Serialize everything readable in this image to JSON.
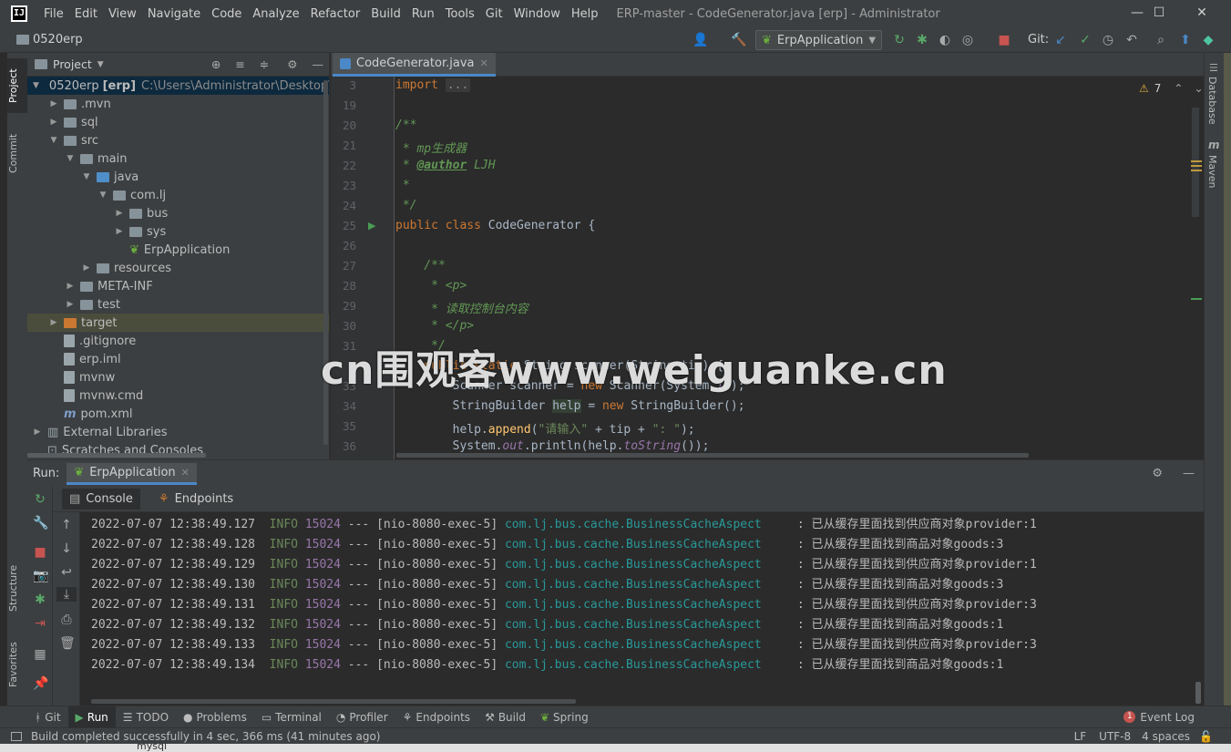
{
  "window": {
    "logo": "IJ",
    "menu": [
      "File",
      "Edit",
      "View",
      "Navigate",
      "Code",
      "Analyze",
      "Refactor",
      "Build",
      "Run",
      "Tools",
      "Git",
      "Window",
      "Help"
    ],
    "title": "ERP-master - CodeGenerator.java [erp] - Administrator",
    "minimize": "—",
    "maximize": "☐",
    "close": "✕"
  },
  "navbar": {
    "project": "0520erp",
    "run_config": "ErpApplication",
    "git_label": "Git:"
  },
  "left_strip": {
    "tabs": [
      "Project",
      "Commit",
      "Structure",
      "Favorites"
    ]
  },
  "project_panel": {
    "title": "Project",
    "tree": [
      {
        "label": "0520erp",
        "bold": "[erp]",
        "path": "C:\\Users\\Administrator\\Desktop\\E",
        "depth": 0,
        "arrow": "▼",
        "type": "folder"
      },
      {
        "label": ".mvn",
        "depth": 1,
        "arrow": "▶",
        "type": "folder"
      },
      {
        "label": "sql",
        "depth": 1,
        "arrow": "▶",
        "type": "folder"
      },
      {
        "label": "src",
        "depth": 1,
        "arrow": "▼",
        "type": "folder"
      },
      {
        "label": "main",
        "depth": 2,
        "arrow": "▼",
        "type": "folder"
      },
      {
        "label": "java",
        "depth": 3,
        "arrow": "▼",
        "type": "folder-blue"
      },
      {
        "label": "com.lj",
        "depth": 4,
        "arrow": "▼",
        "type": "folder"
      },
      {
        "label": "bus",
        "depth": 5,
        "arrow": "▶",
        "type": "folder"
      },
      {
        "label": "sys",
        "depth": 5,
        "arrow": "▶",
        "type": "folder"
      },
      {
        "label": "ErpApplication",
        "depth": 5,
        "arrow": "",
        "type": "spring"
      },
      {
        "label": "resources",
        "depth": 3,
        "arrow": "▶",
        "type": "folder"
      },
      {
        "label": "META-INF",
        "depth": 2,
        "arrow": "▶",
        "type": "folder"
      },
      {
        "label": "test",
        "depth": 2,
        "arrow": "▶",
        "type": "folder"
      },
      {
        "label": "target",
        "depth": 1,
        "arrow": "▶",
        "type": "folder-orange"
      },
      {
        "label": ".gitignore",
        "depth": 1,
        "arrow": "",
        "type": "file"
      },
      {
        "label": "erp.iml",
        "depth": 1,
        "arrow": "",
        "type": "file"
      },
      {
        "label": "mvnw",
        "depth": 1,
        "arrow": "",
        "type": "file"
      },
      {
        "label": "mvnw.cmd",
        "depth": 1,
        "arrow": "",
        "type": "file"
      },
      {
        "label": "pom.xml",
        "depth": 1,
        "arrow": "",
        "type": "maven"
      },
      {
        "label": "External Libraries",
        "depth": 0,
        "arrow": "▶",
        "type": "lib"
      },
      {
        "label": "Scratches and Consoles",
        "depth": 0,
        "arrow": "",
        "type": "scratch"
      }
    ]
  },
  "editor": {
    "tab": "CodeGenerator.java",
    "warnings": "7",
    "line_numbers": [
      "3",
      "19",
      "20",
      "21",
      "22",
      "23",
      "24",
      "25",
      "26",
      "27",
      "28",
      "29",
      "30",
      "31",
      "33",
      "34",
      "35",
      "36"
    ],
    "code": {
      "l3_kw": "import",
      "l3_fold": "...",
      "l20": "/**",
      "l21a": " * ",
      "l21b": "mp生成器",
      "l22a": " * ",
      "l22tag": "@author",
      "l22b": " LJH",
      "l23": " *",
      "l24": " */",
      "l25_kw": "public class",
      "l25_rest": " CodeGenerator {",
      "l27": "    /**",
      "l28": "     * <p>",
      "l29": "     * 读取控制台内容",
      "l30": "     * </p>",
      "l31": "     */",
      "l32_kw": "    public static",
      "l32_rest": " String scanner(String tip) {",
      "l33a": "        Scanner scanner = ",
      "l33kw": "new",
      "l33b": " Scanner(System.",
      "l33fld": "in",
      "l33c": ");",
      "l34a": "        StringBuilder ",
      "l34hl": "help",
      "l34b": " = ",
      "l34kw": "new",
      "l34c": " StringBuilder();",
      "l35a": "        help.",
      "l35fn": "append",
      "l35b": "(",
      "l35str": "\"请输入\"",
      "l35c": " + tip + ",
      "l35str2": "\": \"",
      "l35d": ");",
      "l36a": "        System.",
      "l36fld": "out",
      "l36b": ".println(help.",
      "l36fn": "toString",
      "l36c": "());"
    }
  },
  "watermark": "cn围观客www.weiguanke.cn",
  "run_panel": {
    "label": "Run:",
    "tab": "ErpApplication",
    "console_tab": "Console",
    "endpoints_tab": "Endpoints",
    "logs": [
      {
        "ts": "2022-07-07 12:38:49.127",
        "lvl": "INFO",
        "pid": "15024",
        "thread": "--- [nio-8080-exec-5]",
        "cls": "com.lj.bus.cache.BusinessCacheAspect",
        "msg": ": 已从缓存里面找到供应商对象provider:1"
      },
      {
        "ts": "2022-07-07 12:38:49.128",
        "lvl": "INFO",
        "pid": "15024",
        "thread": "--- [nio-8080-exec-5]",
        "cls": "com.lj.bus.cache.BusinessCacheAspect",
        "msg": ": 已从缓存里面找到商品对象goods:3"
      },
      {
        "ts": "2022-07-07 12:38:49.129",
        "lvl": "INFO",
        "pid": "15024",
        "thread": "--- [nio-8080-exec-5]",
        "cls": "com.lj.bus.cache.BusinessCacheAspect",
        "msg": ": 已从缓存里面找到供应商对象provider:1"
      },
      {
        "ts": "2022-07-07 12:38:49.130",
        "lvl": "INFO",
        "pid": "15024",
        "thread": "--- [nio-8080-exec-5]",
        "cls": "com.lj.bus.cache.BusinessCacheAspect",
        "msg": ": 已从缓存里面找到商品对象goods:3"
      },
      {
        "ts": "2022-07-07 12:38:49.131",
        "lvl": "INFO",
        "pid": "15024",
        "thread": "--- [nio-8080-exec-5]",
        "cls": "com.lj.bus.cache.BusinessCacheAspect",
        "msg": ": 已从缓存里面找到供应商对象provider:3"
      },
      {
        "ts": "2022-07-07 12:38:49.132",
        "lvl": "INFO",
        "pid": "15024",
        "thread": "--- [nio-8080-exec-5]",
        "cls": "com.lj.bus.cache.BusinessCacheAspect",
        "msg": ": 已从缓存里面找到商品对象goods:1"
      },
      {
        "ts": "2022-07-07 12:38:49.133",
        "lvl": "INFO",
        "pid": "15024",
        "thread": "--- [nio-8080-exec-5]",
        "cls": "com.lj.bus.cache.BusinessCacheAspect",
        "msg": ": 已从缓存里面找到供应商对象provider:3"
      },
      {
        "ts": "2022-07-07 12:38:49.134",
        "lvl": "INFO",
        "pid": "15024",
        "thread": "--- [nio-8080-exec-5]",
        "cls": "com.lj.bus.cache.BusinessCacheAspect",
        "msg": ": 已从缓存里面找到商品对象goods:1"
      }
    ]
  },
  "right_strip": {
    "tabs": [
      "Database",
      "Maven"
    ]
  },
  "toolwindows": [
    {
      "label": "Git",
      "icon": "git-icon",
      "glyph": "ᚼ"
    },
    {
      "label": "Run",
      "icon": "run-icon",
      "glyph": "▶"
    },
    {
      "label": "TODO",
      "icon": "todo-icon",
      "glyph": "☰"
    },
    {
      "label": "Problems",
      "icon": "problems-icon",
      "glyph": "●"
    },
    {
      "label": "Terminal",
      "icon": "terminal-icon",
      "glyph": "▭"
    },
    {
      "label": "Profiler",
      "icon": "profiler-icon",
      "glyph": "◔"
    },
    {
      "label": "Endpoints",
      "icon": "endpoints-icon",
      "glyph": "⚘"
    },
    {
      "label": "Build",
      "icon": "build-icon",
      "glyph": "⚒"
    },
    {
      "label": "Spring",
      "icon": "spring-icon",
      "glyph": "❦"
    }
  ],
  "event_log": {
    "count": "1",
    "label": "Event Log"
  },
  "status": {
    "message": "Build completed successfully in 4 sec, 366 ms (41 minutes ago)",
    "line_sep": "LF",
    "encoding": "UTF-8",
    "indent": "4 spaces"
  },
  "desktop": {
    "item": "mysql"
  },
  "colors": {
    "accent": "#4a88c7",
    "keyword": "#cc7832",
    "comment": "#629755",
    "string": "#6a8759",
    "class_link": "#299999"
  }
}
